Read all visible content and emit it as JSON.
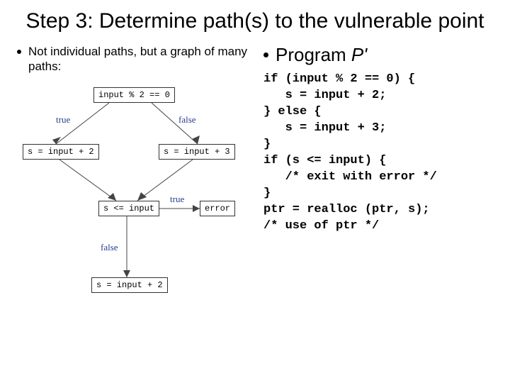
{
  "title": "Step 3: Determine path(s) to the vulnerable point",
  "left": {
    "bullet": "Not individual paths, but a graph of many paths:"
  },
  "right": {
    "bullet_prefix": "Program ",
    "bullet_em": "P'"
  },
  "flow": {
    "n1": "input % 2 == 0",
    "n2": "s = input + 2",
    "n3": "s = input + 3",
    "n4": "s <= input",
    "n5": "error",
    "n6": "s = input + 2",
    "e_true": "true",
    "e_false": "false"
  },
  "code_lines": [
    "if (input % 2 == 0) {",
    "   s = input + 2;",
    "} else {",
    "   s = input + 3;",
    "}",
    "if (s <= input) {",
    "   /* exit with error */",
    "}",
    "ptr = realloc (ptr, s);",
    "/* use of ptr */"
  ]
}
